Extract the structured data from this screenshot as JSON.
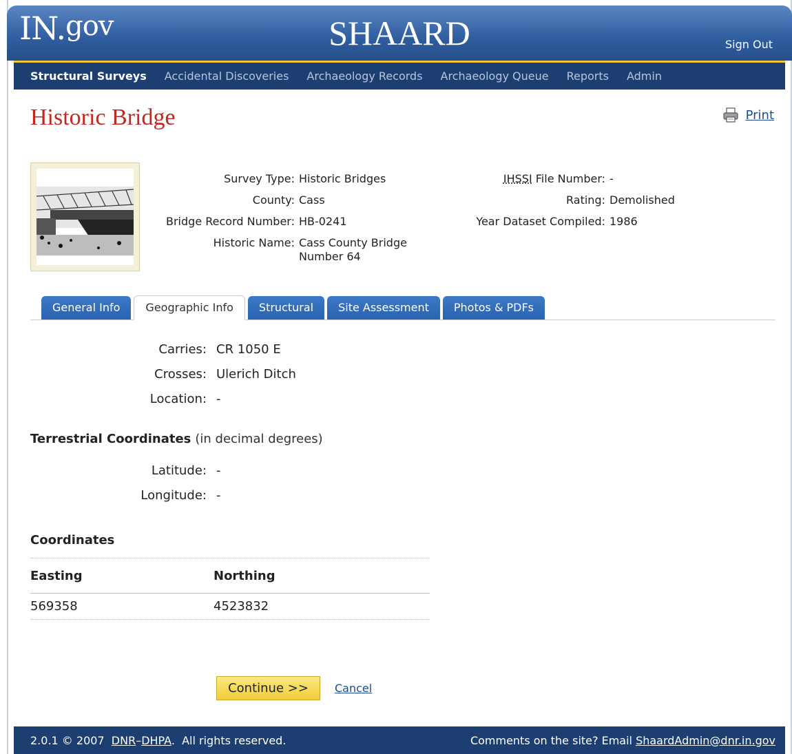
{
  "header": {
    "logo_main": "IN.",
    "logo_sup": "gov",
    "app_title": "SHAARD",
    "sign_out": "Sign Out"
  },
  "nav": {
    "items": [
      {
        "label": "Structural Surveys",
        "active": true
      },
      {
        "label": "Accidental Discoveries"
      },
      {
        "label": "Archaeology Records"
      },
      {
        "label": "Archaeology Queue"
      },
      {
        "label": "Reports"
      },
      {
        "label": "Admin"
      }
    ]
  },
  "page": {
    "title": "Historic Bridge",
    "print_label": "Print"
  },
  "summary": {
    "survey_type_label": "Survey Type:",
    "survey_type": "Historic Bridges",
    "county_label": "County:",
    "county": "Cass",
    "bridge_record_label": "Bridge Record Number:",
    "bridge_record": "HB-0241",
    "historic_name_label": "Historic Name:",
    "historic_name": "Cass County Bridge Number 64",
    "ihssi_abbr": "IHSSI",
    "ihssi_label_rest": " File Number:",
    "ihssi_value": "-",
    "rating_label": "Rating:",
    "rating": "Demolished",
    "year_label": "Year Dataset Compiled:",
    "year": "1986"
  },
  "tabs": [
    {
      "label": "General Info"
    },
    {
      "label": "Geographic Info",
      "active": true
    },
    {
      "label": "Structural"
    },
    {
      "label": "Site Assessment"
    },
    {
      "label": "Photos & PDFs"
    }
  ],
  "geo": {
    "carries_label": "Carries:",
    "carries": "CR 1050 E",
    "crosses_label": "Crosses:",
    "crosses": "Ulerich Ditch",
    "location_label": "Location:",
    "location": "-",
    "terrestrial_title": "Terrestrial Coordinates",
    "terrestrial_note": "(in decimal degrees)",
    "latitude_label": "Latitude:",
    "latitude": "-",
    "longitude_label": "Longitude:",
    "longitude": "-"
  },
  "coordinates": {
    "title": "Coordinates",
    "columns": [
      "Easting",
      "Northing"
    ],
    "rows": [
      [
        "569358",
        "4523832"
      ]
    ]
  },
  "actions": {
    "continue": "Continue >>",
    "cancel": "Cancel"
  },
  "footer": {
    "left_prefix": "2.0.1 © 2007",
    "dnr": "DNR",
    "dash": "–",
    "dhpa": "DHPA",
    "left_suffix": ".  All rights reserved.",
    "right_prefix": "Comments on the site? Email ",
    "email": "ShaardAdmin@dnr.in.gov"
  }
}
